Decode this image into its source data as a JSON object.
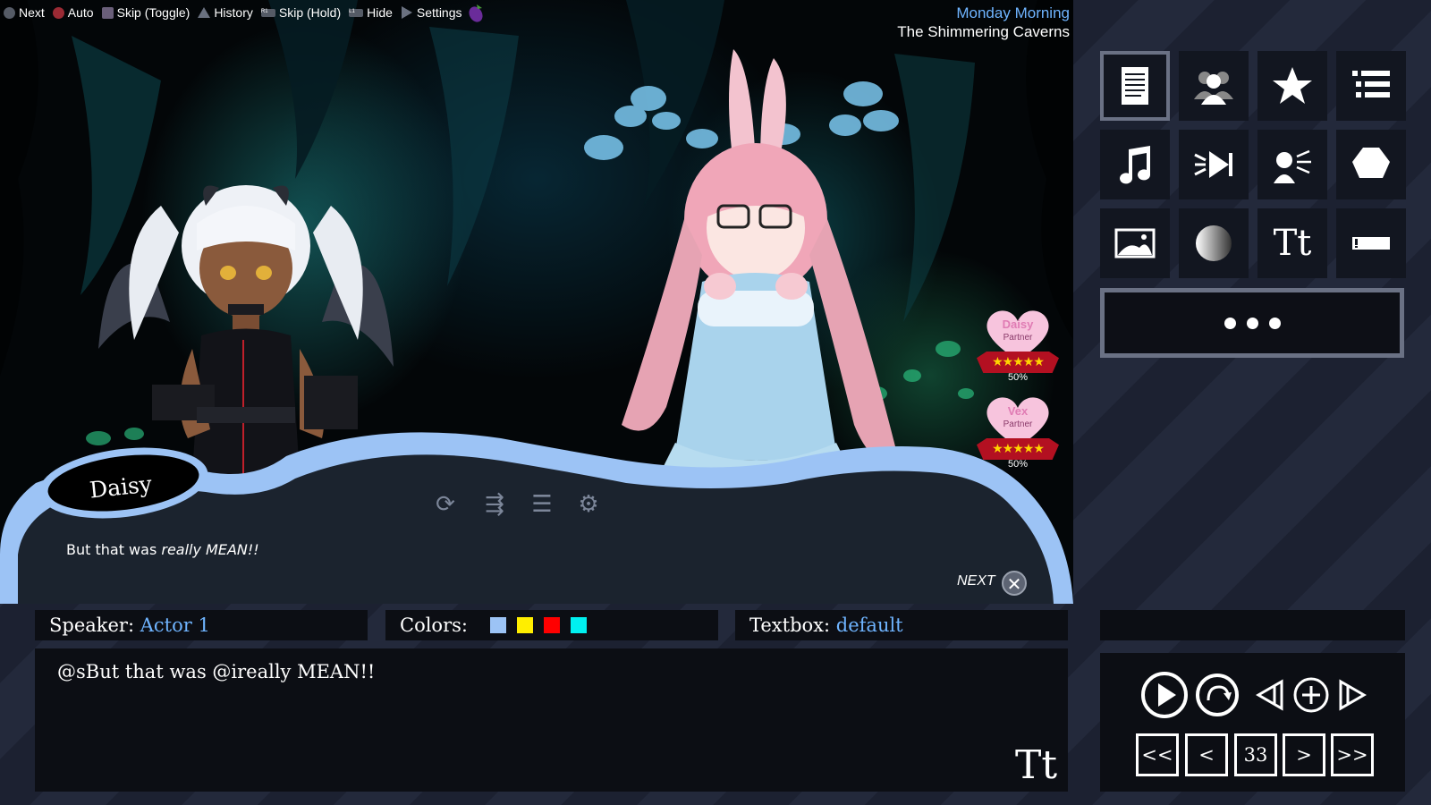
{
  "controls_hint": [
    {
      "label": "Next",
      "glyph": "cross-button-icon"
    },
    {
      "label": "Auto",
      "glyph": "circle-button-icon"
    },
    {
      "label": "Skip (Toggle)",
      "glyph": "square-button-icon"
    },
    {
      "label": "History",
      "glyph": "triangle-button-icon"
    },
    {
      "label": "Skip (Hold)",
      "glyph": "r1-button-icon"
    },
    {
      "label": "Hide",
      "glyph": "l1-button-icon"
    },
    {
      "label": "Settings",
      "glyph": "select-button-icon"
    }
  ],
  "hint_glyph_text": {
    "r1": "R1",
    "l1": "L1"
  },
  "time": {
    "day": "Monday",
    "period": "Morning",
    "location": "The Shimmering Caverns"
  },
  "affection": [
    {
      "name": "Daisy",
      "role": "Partner",
      "stars": "★★★★★",
      "percent": "50%"
    },
    {
      "name": "Vex",
      "role": "Partner",
      "stars": "★★★★★",
      "percent": "50%"
    }
  ],
  "dialog": {
    "speaker": "Daisy",
    "text_plain": "But that was ",
    "text_italic": "really MEAN!!",
    "next_label": "NEXT"
  },
  "textbox_icons": [
    "repeat-icon",
    "skip-icon",
    "history-list-icon",
    "settings-gears-icon"
  ],
  "toolbar": {
    "rows": [
      [
        "document-icon",
        "characters-icon",
        "star-icon",
        "list-icon"
      ],
      [
        "music-note-icon",
        "sound-effect-icon",
        "voice-icon",
        "shape-icon"
      ],
      [
        "background-image-icon",
        "lighting-icon",
        "text-style-icon",
        "textbox-icon"
      ]
    ],
    "text_style_glyph": "Tt",
    "more_label": "more"
  },
  "editor": {
    "speaker_label": "Speaker:",
    "speaker_value": "Actor 1",
    "colors_label": "Colors:",
    "colors": [
      "#9cc3f5",
      "#ffee00",
      "#ff0000",
      "#00f0f0"
    ],
    "textbox_label": "Textbox:",
    "textbox_value": "default",
    "script_text": "@sBut that was @ireally MEAN!!",
    "script_font_glyph": "Tt"
  },
  "playback": {
    "icons": [
      "play-icon",
      "redo-icon",
      "previous-icon",
      "add-icon",
      "next-icon"
    ],
    "nav": [
      "<<",
      "<",
      "33",
      ">",
      ">>"
    ]
  },
  "colors": {
    "accent_blue": "#6fb4ff",
    "textbox_frame": "#9cc3f5",
    "panel_bg": "#0c0e14"
  }
}
